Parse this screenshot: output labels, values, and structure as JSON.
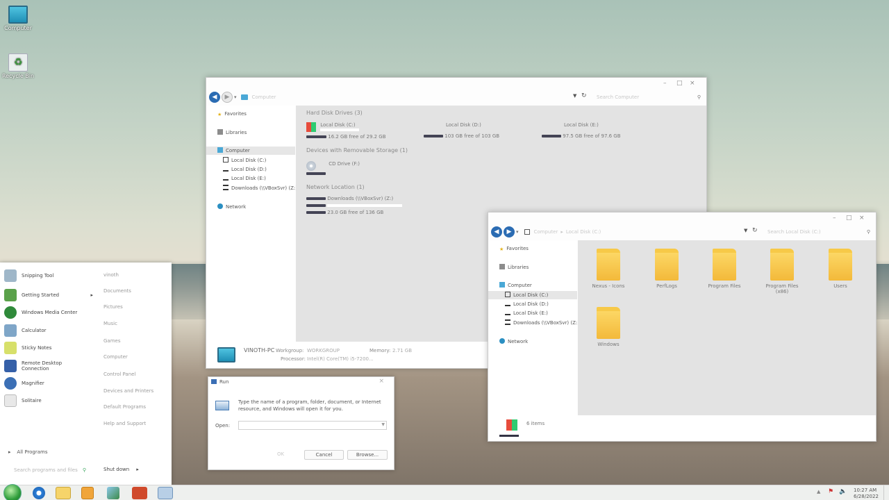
{
  "desktop": {
    "icons": [
      {
        "label": "Computer",
        "icon": "computer-monitor-icon"
      },
      {
        "label": "Recycle Bin",
        "icon": "recycle-bin-icon"
      }
    ]
  },
  "explorer_computer": {
    "window_controls": {
      "minimize": "–",
      "maximize": "□",
      "close": "×"
    },
    "breadcrumb": "Computer",
    "search_placeholder": "Search Computer",
    "nav": [
      {
        "label": "Favorites"
      },
      {
        "label": "Libraries"
      },
      {
        "label": "Computer"
      },
      {
        "label": "Local Disk (C:)"
      },
      {
        "label": "Local Disk (D:)"
      },
      {
        "label": "Local Disk (E:)"
      },
      {
        "label": "Downloads (\\\\VBoxSvr) (Z:)"
      },
      {
        "label": "Network"
      }
    ],
    "sections": {
      "hdd": "Hard Disk Drives (3)",
      "removable": "Devices with Removable Storage (1)",
      "network": "Network Location (1)"
    },
    "drives": [
      {
        "name": "Local Disk (C:)",
        "free": "16.2 GB free of 29.2 GB",
        "used_fraction": 0.45
      },
      {
        "name": "Local Disk (D:)",
        "free": "103 GB free of 103 GB",
        "used_fraction": 0.0
      },
      {
        "name": "Local Disk (E:)",
        "free": "97.5 GB free of 97.6 GB",
        "used_fraction": 0.0
      }
    ],
    "cd": {
      "name": "CD Drive (F:)"
    },
    "netloc": {
      "name": "Downloads (\\\\VBoxSvr) (Z:)",
      "free": "23.0 GB free of 136 GB"
    },
    "details": {
      "pc": "VINOTH-PC",
      "workgroup_label": "Workgroup:",
      "workgroup": "WORKGROUP",
      "memory_label": "Memory:",
      "memory": "2.71 GB",
      "processor_label": "Processor:",
      "processor": "Intel(R) Core(TM) i5-7200..."
    }
  },
  "explorer_c": {
    "breadcrumb": [
      "Computer",
      "Local Disk (C:)"
    ],
    "search_placeholder": "Search Local Disk (C:)",
    "nav": [
      {
        "label": "Favorites"
      },
      {
        "label": "Libraries"
      },
      {
        "label": "Computer"
      },
      {
        "label": "Local Disk (C:)"
      },
      {
        "label": "Local Disk (D:)"
      },
      {
        "label": "Local Disk (E:)"
      },
      {
        "label": "Downloads (\\\\VBoxSvr) (Z:)"
      },
      {
        "label": "Network"
      }
    ],
    "folders": [
      "Nexus - Icons",
      "PerfLogs",
      "Program Files",
      "Program Files (x86)",
      "Users",
      "Windows"
    ],
    "status": "6 items"
  },
  "start_menu": {
    "programs": [
      {
        "label": "Snipping Tool",
        "color": "#9fb7c9"
      },
      {
        "label": "Getting Started",
        "color": "#5aa14a"
      },
      {
        "label": "Windows Media Center",
        "color": "#2f8a3a"
      },
      {
        "label": "Calculator",
        "color": "#7fa6c8"
      },
      {
        "label": "Sticky Notes",
        "color": "#d7e06a"
      },
      {
        "label": "Remote Desktop Connection",
        "color": "#3560a8"
      },
      {
        "label": "Magnifier",
        "color": "#3b6fb5"
      },
      {
        "label": "Solitaire",
        "color": "#e8e8e8"
      }
    ],
    "all_programs": "All Programs",
    "search_placeholder": "Search programs and files",
    "places": [
      "vinoth",
      "Documents",
      "Pictures",
      "Music",
      "Games",
      "Computer",
      "Control Panel",
      "Devices and Printers",
      "Default Programs",
      "Help and Support"
    ],
    "shutdown": "Shut down",
    "submenu_arrow": "▸"
  },
  "run_dialog": {
    "title": "Run",
    "close": "×",
    "message": "Type the name of a program, folder, document, or Internet resource, and Windows will open it for you.",
    "open_label": "Open:",
    "open_value": "",
    "ok": "OK",
    "cancel": "Cancel",
    "browse": "Browse..."
  },
  "taskbar": {
    "time": "10:27 AM",
    "date": "6/28/2022"
  }
}
